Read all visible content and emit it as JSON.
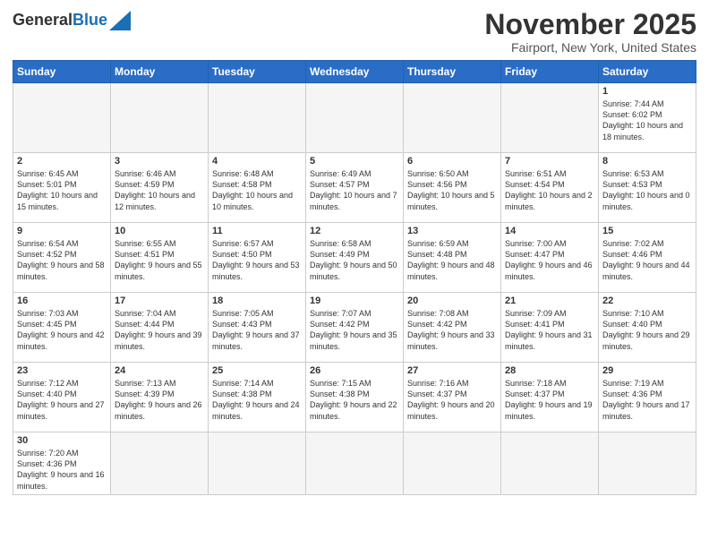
{
  "header": {
    "logo_general": "General",
    "logo_blue": "Blue",
    "month_title": "November 2025",
    "location": "Fairport, New York, United States"
  },
  "days_of_week": [
    "Sunday",
    "Monday",
    "Tuesday",
    "Wednesday",
    "Thursday",
    "Friday",
    "Saturday"
  ],
  "weeks": [
    [
      {
        "day": "",
        "info": ""
      },
      {
        "day": "",
        "info": ""
      },
      {
        "day": "",
        "info": ""
      },
      {
        "day": "",
        "info": ""
      },
      {
        "day": "",
        "info": ""
      },
      {
        "day": "",
        "info": ""
      },
      {
        "day": "1",
        "info": "Sunrise: 7:44 AM\nSunset: 6:02 PM\nDaylight: 10 hours and 18 minutes."
      }
    ],
    [
      {
        "day": "2",
        "info": "Sunrise: 6:45 AM\nSunset: 5:01 PM\nDaylight: 10 hours and 15 minutes."
      },
      {
        "day": "3",
        "info": "Sunrise: 6:46 AM\nSunset: 4:59 PM\nDaylight: 10 hours and 12 minutes."
      },
      {
        "day": "4",
        "info": "Sunrise: 6:48 AM\nSunset: 4:58 PM\nDaylight: 10 hours and 10 minutes."
      },
      {
        "day": "5",
        "info": "Sunrise: 6:49 AM\nSunset: 4:57 PM\nDaylight: 10 hours and 7 minutes."
      },
      {
        "day": "6",
        "info": "Sunrise: 6:50 AM\nSunset: 4:56 PM\nDaylight: 10 hours and 5 minutes."
      },
      {
        "day": "7",
        "info": "Sunrise: 6:51 AM\nSunset: 4:54 PM\nDaylight: 10 hours and 2 minutes."
      },
      {
        "day": "8",
        "info": "Sunrise: 6:53 AM\nSunset: 4:53 PM\nDaylight: 10 hours and 0 minutes."
      }
    ],
    [
      {
        "day": "9",
        "info": "Sunrise: 6:54 AM\nSunset: 4:52 PM\nDaylight: 9 hours and 58 minutes."
      },
      {
        "day": "10",
        "info": "Sunrise: 6:55 AM\nSunset: 4:51 PM\nDaylight: 9 hours and 55 minutes."
      },
      {
        "day": "11",
        "info": "Sunrise: 6:57 AM\nSunset: 4:50 PM\nDaylight: 9 hours and 53 minutes."
      },
      {
        "day": "12",
        "info": "Sunrise: 6:58 AM\nSunset: 4:49 PM\nDaylight: 9 hours and 50 minutes."
      },
      {
        "day": "13",
        "info": "Sunrise: 6:59 AM\nSunset: 4:48 PM\nDaylight: 9 hours and 48 minutes."
      },
      {
        "day": "14",
        "info": "Sunrise: 7:00 AM\nSunset: 4:47 PM\nDaylight: 9 hours and 46 minutes."
      },
      {
        "day": "15",
        "info": "Sunrise: 7:02 AM\nSunset: 4:46 PM\nDaylight: 9 hours and 44 minutes."
      }
    ],
    [
      {
        "day": "16",
        "info": "Sunrise: 7:03 AM\nSunset: 4:45 PM\nDaylight: 9 hours and 42 minutes."
      },
      {
        "day": "17",
        "info": "Sunrise: 7:04 AM\nSunset: 4:44 PM\nDaylight: 9 hours and 39 minutes."
      },
      {
        "day": "18",
        "info": "Sunrise: 7:05 AM\nSunset: 4:43 PM\nDaylight: 9 hours and 37 minutes."
      },
      {
        "day": "19",
        "info": "Sunrise: 7:07 AM\nSunset: 4:42 PM\nDaylight: 9 hours and 35 minutes."
      },
      {
        "day": "20",
        "info": "Sunrise: 7:08 AM\nSunset: 4:42 PM\nDaylight: 9 hours and 33 minutes."
      },
      {
        "day": "21",
        "info": "Sunrise: 7:09 AM\nSunset: 4:41 PM\nDaylight: 9 hours and 31 minutes."
      },
      {
        "day": "22",
        "info": "Sunrise: 7:10 AM\nSunset: 4:40 PM\nDaylight: 9 hours and 29 minutes."
      }
    ],
    [
      {
        "day": "23",
        "info": "Sunrise: 7:12 AM\nSunset: 4:40 PM\nDaylight: 9 hours and 27 minutes."
      },
      {
        "day": "24",
        "info": "Sunrise: 7:13 AM\nSunset: 4:39 PM\nDaylight: 9 hours and 26 minutes."
      },
      {
        "day": "25",
        "info": "Sunrise: 7:14 AM\nSunset: 4:38 PM\nDaylight: 9 hours and 24 minutes."
      },
      {
        "day": "26",
        "info": "Sunrise: 7:15 AM\nSunset: 4:38 PM\nDaylight: 9 hours and 22 minutes."
      },
      {
        "day": "27",
        "info": "Sunrise: 7:16 AM\nSunset: 4:37 PM\nDaylight: 9 hours and 20 minutes."
      },
      {
        "day": "28",
        "info": "Sunrise: 7:18 AM\nSunset: 4:37 PM\nDaylight: 9 hours and 19 minutes."
      },
      {
        "day": "29",
        "info": "Sunrise: 7:19 AM\nSunset: 4:36 PM\nDaylight: 9 hours and 17 minutes."
      }
    ],
    [
      {
        "day": "30",
        "info": "Sunrise: 7:20 AM\nSunset: 4:36 PM\nDaylight: 9 hours and 16 minutes."
      },
      {
        "day": "",
        "info": ""
      },
      {
        "day": "",
        "info": ""
      },
      {
        "day": "",
        "info": ""
      },
      {
        "day": "",
        "info": ""
      },
      {
        "day": "",
        "info": ""
      },
      {
        "day": "",
        "info": ""
      }
    ]
  ]
}
